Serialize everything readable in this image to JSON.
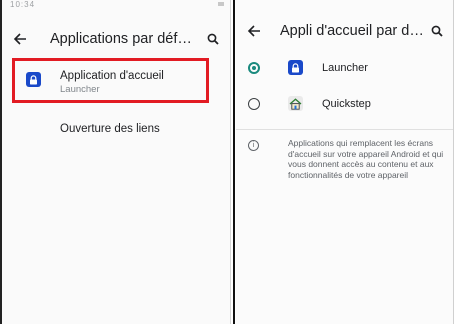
{
  "left_screen": {
    "status_time": "10:34",
    "title": "Applications par déf…",
    "items": [
      {
        "title": "Application d'accueil",
        "subtitle": "Launcher"
      },
      {
        "title": "Ouverture des liens"
      }
    ],
    "highlight_color": "#e21b23"
  },
  "right_screen": {
    "title": "Appli d'accueil par d…",
    "options": [
      {
        "label": "Launcher",
        "selected": true,
        "icon": "lock-badge-icon"
      },
      {
        "label": "Quickstep",
        "selected": false,
        "icon": "home-icon"
      }
    ],
    "info_text": "Applications qui remplacent les écrans d'accueil sur votre appareil Android et qui vous donnent accès au contenu et aux fonctionnalités de votre appareil"
  },
  "colors": {
    "accent_radio": "#1a8a7e",
    "lock_badge": "#1a49c9"
  }
}
